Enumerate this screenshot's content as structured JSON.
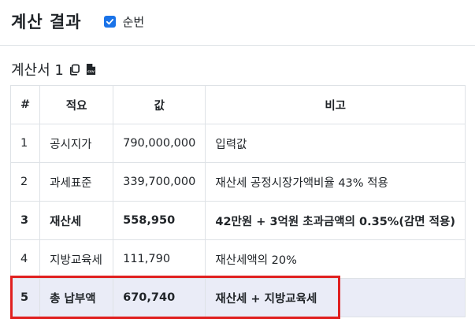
{
  "header": {
    "title": "계산 결과",
    "checkbox_label": "순번",
    "checkbox_checked": true
  },
  "subheader": {
    "title": "계산서 1",
    "copy_icon": "copy-icon",
    "csv_icon": "csv-file-icon"
  },
  "table": {
    "headers": [
      "#",
      "적요",
      "값",
      "비고"
    ],
    "rows": [
      {
        "num": "1",
        "name": "공시지가",
        "value": "790,000,000",
        "note": "입력값",
        "bold": false
      },
      {
        "num": "2",
        "name": "과세표준",
        "value": "339,700,000",
        "note": "재산세 공정시장가액비율 43% 적용",
        "bold": false
      },
      {
        "num": "3",
        "name": "재산세",
        "value": "558,950",
        "note": "42만원 + 3억원 초과금액의 0.35%(감면 적용)",
        "bold": true
      },
      {
        "num": "4",
        "name": "지방교육세",
        "value": "111,790",
        "note": "재산세액의 20%",
        "bold": false
      },
      {
        "num": "5",
        "name": "총 납부액",
        "value": "670,740",
        "note": "재산세 + 지방교육세",
        "bold": true
      }
    ]
  },
  "colors": {
    "accent": "#1a73e8",
    "highlight_border": "#e02020",
    "highlight_row": "#eaecf7"
  }
}
